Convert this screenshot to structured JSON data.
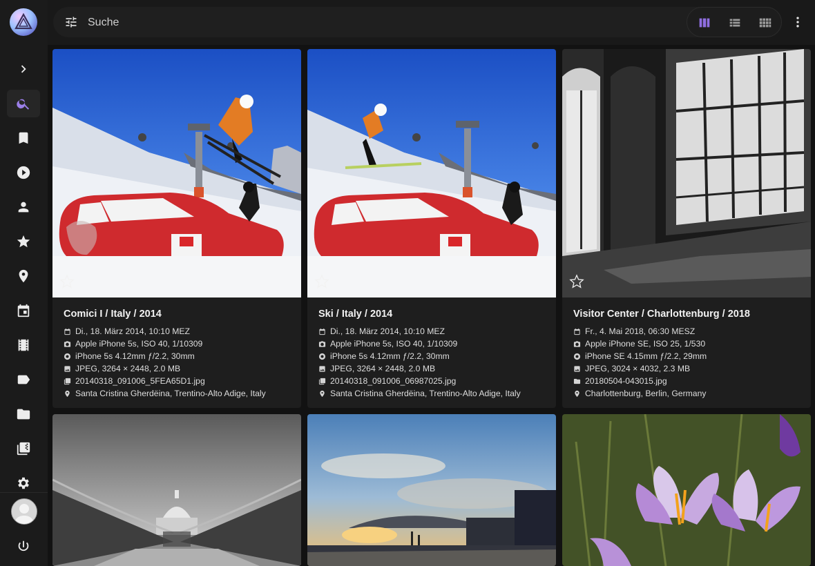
{
  "search": {
    "placeholder": "Suche"
  },
  "nav": [
    {
      "icon": "chevron-right-icon"
    },
    {
      "icon": "search-icon",
      "active": true
    },
    {
      "icon": "bookmark-icon"
    },
    {
      "icon": "play-circle-icon"
    },
    {
      "icon": "person-icon"
    },
    {
      "icon": "star-icon"
    },
    {
      "icon": "map-pin-icon"
    },
    {
      "icon": "calendar-icon"
    },
    {
      "icon": "film-icon"
    },
    {
      "icon": "label-icon"
    },
    {
      "icon": "folder-icon"
    },
    {
      "icon": "library-icon"
    },
    {
      "icon": "gear-icon"
    },
    {
      "icon": "power-icon"
    }
  ],
  "view_modes": [
    {
      "icon": "cards-view-icon",
      "active": true
    },
    {
      "icon": "list-view-icon"
    },
    {
      "icon": "mosaic-view-icon"
    }
  ],
  "accent": "#8f6ee0",
  "photos": [
    {
      "title": "Comici I / Italy / 2014",
      "date": "Di., 18. März 2014, 10:10 MEZ",
      "camera": "Apple iPhone 5s, ISO 40, 1/10309",
      "lens": "iPhone 5s 4.12mm ƒ/2.2, 30mm",
      "file_info": "JPEG, 3264 × 2448, 2.0 MB",
      "filename": "20140318_091006_5FEA65D1.jpg",
      "location": "Santa Cristina Gherdëina, Trentino-Alto Adige, Italy"
    },
    {
      "title": "Ski / Italy / 2014",
      "date": "Di., 18. März 2014, 10:10 MEZ",
      "camera": "Apple iPhone 5s, ISO 40, 1/10309",
      "lens": "iPhone 5s 4.12mm ƒ/2.2, 30mm",
      "file_info": "JPEG, 3264 × 2448, 2.0 MB",
      "filename": "20140318_091006_06987025.jpg",
      "location": "Santa Cristina Gherdëina, Trentino-Alto Adige, Italy"
    },
    {
      "title": "Visitor Center / Charlottenburg / 2018",
      "date": "Fr., 4. Mai 2018, 06:30 MESZ",
      "camera": "Apple iPhone SE, ISO 25, 1/530",
      "lens": "iPhone SE 4.15mm ƒ/2.2, 29mm",
      "file_info": "JPEG, 3024 × 4032, 2.3 MB",
      "filename": "20180504-043015.jpg",
      "location": "Charlottenburg, Berlin, Germany"
    }
  ]
}
